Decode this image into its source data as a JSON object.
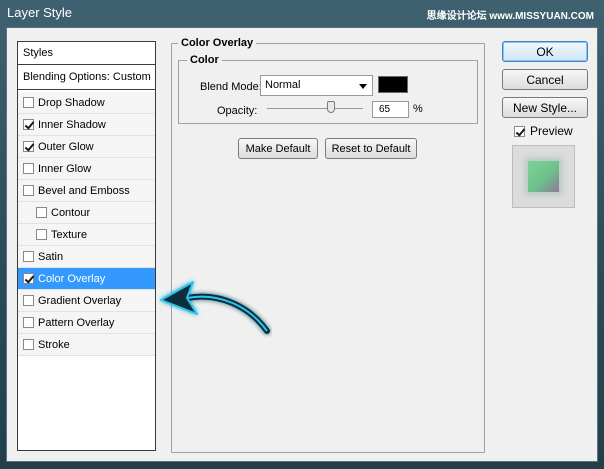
{
  "window": {
    "title": "Layer Style",
    "watermark": "思缘设计论坛 www.MISSYUAN.COM"
  },
  "styles_panel": {
    "header": "Styles",
    "blending": "Blending Options: Custom",
    "items": [
      {
        "label": "Drop Shadow",
        "checked": false,
        "sub": false,
        "selected": false
      },
      {
        "label": "Inner Shadow",
        "checked": true,
        "sub": false,
        "selected": false
      },
      {
        "label": "Outer Glow",
        "checked": true,
        "sub": false,
        "selected": false
      },
      {
        "label": "Inner Glow",
        "checked": false,
        "sub": false,
        "selected": false
      },
      {
        "label": "Bevel and Emboss",
        "checked": false,
        "sub": false,
        "selected": false
      },
      {
        "label": "Contour",
        "checked": false,
        "sub": true,
        "selected": false
      },
      {
        "label": "Texture",
        "checked": false,
        "sub": true,
        "selected": false
      },
      {
        "label": "Satin",
        "checked": false,
        "sub": false,
        "selected": false
      },
      {
        "label": "Color Overlay",
        "checked": true,
        "sub": false,
        "selected": true
      },
      {
        "label": "Gradient Overlay",
        "checked": false,
        "sub": false,
        "selected": false
      },
      {
        "label": "Pattern Overlay",
        "checked": false,
        "sub": false,
        "selected": false
      },
      {
        "label": "Stroke",
        "checked": false,
        "sub": false,
        "selected": false
      }
    ]
  },
  "color_overlay": {
    "group_title": "Color Overlay",
    "sub_group_title": "Color",
    "blend_mode_label": "Blend Mode:",
    "blend_mode_value": "Normal",
    "overlay_color": "#000000",
    "opacity_label": "Opacity:",
    "opacity_value": "65",
    "opacity_unit": "%",
    "make_default": "Make Default",
    "reset_default": "Reset to Default"
  },
  "actions": {
    "ok": "OK",
    "cancel": "Cancel",
    "new_style": "New Style...",
    "preview_label": "Preview",
    "preview_checked": true
  },
  "colors": {
    "selection": "#3399ff",
    "arrow": "#1aa9d6"
  }
}
